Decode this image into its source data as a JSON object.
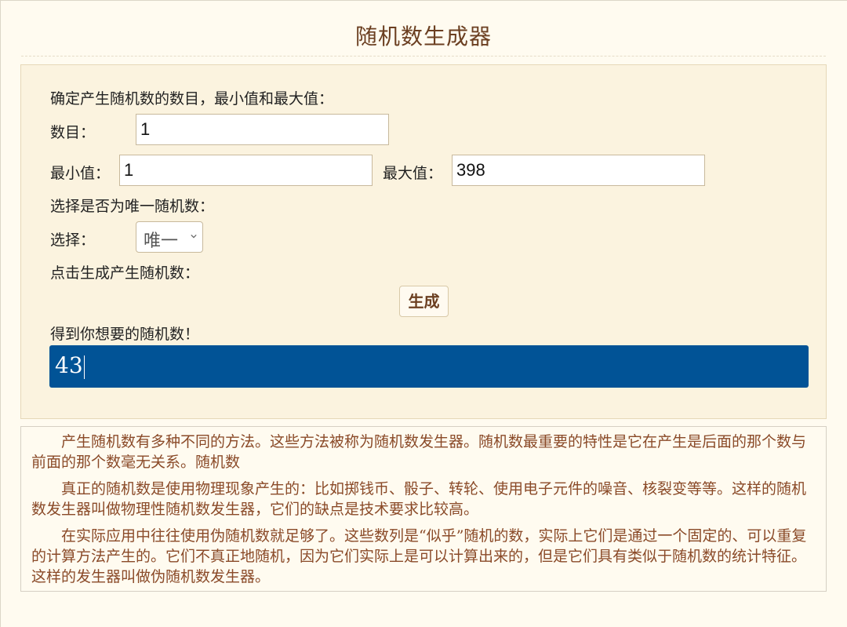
{
  "page": {
    "title": "随机数生成器"
  },
  "form": {
    "intro_label": "确定产生随机数的数目，最小值和最大值：",
    "count_label": "数目：",
    "count_value": "1",
    "min_label": "最小值：",
    "min_value": "1",
    "max_label": "最大值：",
    "max_value": "398",
    "unique_prompt": "选择是否为唯一随机数：",
    "choice_label": "选择：",
    "choice_selected": "唯一",
    "generate_prompt": "点击生成产生随机数：",
    "generate_button": "生成",
    "result_label": "得到你想要的随机数！",
    "result_value": "43"
  },
  "description": {
    "paragraphs": [
      "产生随机数有多种不同的方法。这些方法被称为随机数发生器。随机数最重要的特性是它在产生是后面的那个数与前面的那个数毫无关系。随机数",
      "真正的随机数是使用物理现象产生的：比如掷钱币、骰子、转轮、使用电子元件的噪音、核裂变等等。这样的随机数发生器叫做物理性随机数发生器，它们的缺点是技术要求比较高。",
      "在实际应用中往往使用伪随机数就足够了。这些数列是“似乎”随机的数，实际上它们是通过一个固定的、可以重复的计算方法产生的。它们不真正地随机，因为它们实际上是可以计算出来的，但是它们具有类似于随机数的统计特征。这样的发生器叫做伪随机数发生器。"
    ]
  },
  "colors": {
    "title": "#6b3f21",
    "result_background": "#015396",
    "description_text": "#8a4a28",
    "panel_background": "#fbf3df"
  },
  "icons": {
    "select_arrow": "chevron-down-icon"
  }
}
